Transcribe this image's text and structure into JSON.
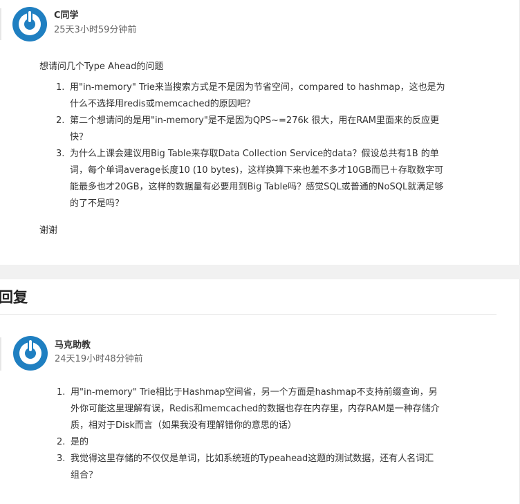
{
  "question": {
    "author": "C同学",
    "time": "25天3小时59分钟前",
    "intro": "想请问几个Type Ahead的问题",
    "items": [
      {
        "num": "1.",
        "lines": [
          "用\"in-memory\" Trie来当搜索方式是不是因为节省空间，compared to hashmap，这也是为",
          "什么不选择用redis或memcached的原因吧？"
        ]
      },
      {
        "num": "2.",
        "lines": [
          "第二个想请问的是用\"in-memory\"是不是因为QPS~=276k 很大，用在RAM里面来的反应更",
          "快？"
        ]
      },
      {
        "num": "3.",
        "lines": [
          "为什么上课会建议用Big Table来存取Data Collection Service的data？假设总共有1B 的单",
          "词，每个单词average长度10 (10 bytes)，这样换算下来也差不多才10GB而已＋存取数字可",
          "能最多也才20GB，这样的数据量有必要用到Big Table吗？感觉SQL或普通的NoSQL就满足够",
          "的了不是吗？"
        ]
      }
    ],
    "closing": "谢谢"
  },
  "reply_heading": "回复",
  "answer": {
    "author": "马克助教",
    "time": "24天19小时48分钟前",
    "items": [
      {
        "num": "1.",
        "lines": [
          "用\"in-memory\" Trie相比于Hashmap空间省，另一个方面是hashmap不支持前缀查询，另",
          "外你可能这里理解有误，Redis和memcached的数据也存在内存里，内存RAM是一种存储介",
          "质，相对于Disk而言（如果我没有理解错你的意思的话）"
        ]
      },
      {
        "num": "2.",
        "lines": [
          "是的"
        ]
      },
      {
        "num": "3.",
        "lines": [
          "我觉得这里存储的不仅仅是单词，比如系统班的Typeahead这题的测试数据，还有人名词汇",
          "组合？"
        ]
      }
    ]
  },
  "colors": {
    "avatar_blue": "#1f7fc1",
    "section_gap": "#f1f1f1"
  },
  "icons": {
    "avatar": "power-symbol-avatar-icon"
  }
}
